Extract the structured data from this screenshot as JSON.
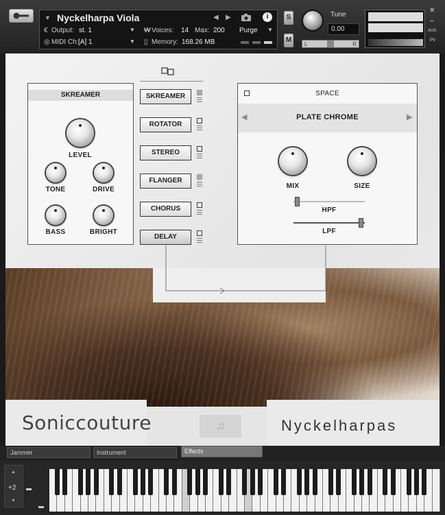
{
  "header": {
    "instrument_name": "Nyckelharpa Viola",
    "output_label": "Output:",
    "output_value": "st. 1",
    "voices_label": "Voices:",
    "voices_value": "14",
    "max_label": "Max:",
    "max_value": "200",
    "purge_label": "Purge",
    "midi_label": "MIDI Ch:",
    "midi_value": "[A]  1",
    "memory_label": "Memory:",
    "memory_value": "168.26 MB",
    "solo_label": "S",
    "mute_label": "M",
    "tune_label": "Tune",
    "tune_value": "0.00",
    "pan_left": "L",
    "pan_right": "R",
    "aux_label": "AUX",
    "pv_label": "PV",
    "close_symbol": "✕",
    "minimize_symbol": "–"
  },
  "skreamer": {
    "title": "SKREAMER",
    "knobs": [
      {
        "label": "LEVEL"
      },
      {
        "label": "TONE"
      },
      {
        "label": "DRIVE"
      },
      {
        "label": "BASS"
      },
      {
        "label": "BRIGHT"
      }
    ]
  },
  "fx_chain": [
    "SKREAMER",
    "ROTATOR",
    "STEREO",
    "FLANGER",
    "CHORUS",
    "DELAY"
  ],
  "space": {
    "title": "SPACE",
    "preset": "PLATE CHROME",
    "mix_label": "MIX",
    "size_label": "SIZE",
    "hpf_label": "HPF",
    "lpf_label": "LPF",
    "hpf_value": 0.02,
    "lpf_value": 0.98
  },
  "brand": {
    "company": "Soniccouture",
    "product": "Nyckelharpas",
    "note_icon": "♫"
  },
  "tabs": [
    "Jammer",
    "Instrument",
    "Effects"
  ],
  "keyboard": {
    "octave_value": "+2"
  },
  "colors": {
    "panel": "#eeeeee",
    "frame": "#555555",
    "header": "#2a2a2a"
  }
}
